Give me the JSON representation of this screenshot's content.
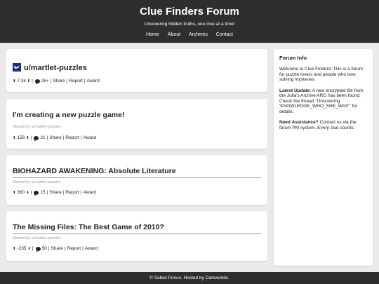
{
  "header": {
    "title": "Clue Finders Forum",
    "tagline": "Uncovering hidden truths, one clue at a time!",
    "nav": [
      "Home",
      "About",
      "Archives",
      "Contact"
    ]
  },
  "user_card": {
    "username": "u/martlet-puzzles",
    "upvotes": "7.3k",
    "comments": "2k+",
    "share": "Share",
    "report": "Report",
    "award": "Award"
  },
  "posts": [
    {
      "title": "I'm creating a new puzzle game!",
      "meta": "Started by u/martlet-puzzles",
      "votes": "156",
      "comments": "21"
    },
    {
      "title": "BIOHAZARD AWAKENING: Absolute Literature",
      "meta": "Started by u/martlet-puzzles",
      "votes": "360",
      "comments": "15"
    },
    {
      "title": "The Missing Files: The Best Game of 2010?",
      "meta": "Started by u/martlet-puzzles",
      "votes": "-235",
      "comments": "50"
    }
  ],
  "actions": {
    "share": "Share",
    "report": "Report",
    "award": "Award"
  },
  "sidebar": {
    "title": "Forum Info",
    "welcome": "Welcome to Clue Finders! This is a forum for puzzle lovers and people who love solving mysteries.",
    "update_label": "Latest Update:",
    "update_text": " A new encrypted file from the Julia's Archive ARG has been found. Check the thread \"Uncovering 'KNOWLEDGE_WHO_SHE_WAS'\" for details.",
    "help_label": "Need Assistance?",
    "help_text": " Contact us via the forum PM system. Every clue counts."
  },
  "footer": {
    "text": "© Sabiel Ponco. Hosted by Darkworlds."
  },
  "colors": {
    "header_bg": "#2e2e2e",
    "page_bg": "#eaeaea",
    "avatar_bg": "#1c2a8c"
  }
}
